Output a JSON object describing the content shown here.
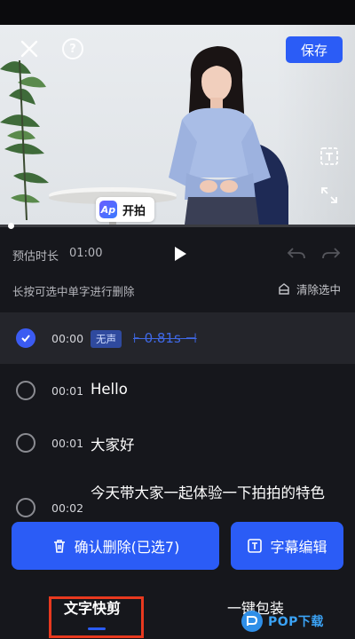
{
  "header": {
    "save_label": "保存",
    "help_glyph": "?"
  },
  "video": {
    "logo_mark": "Ap",
    "logo_text": "开拍",
    "progress": 0.02
  },
  "controls": {
    "estimate_label": "预估时长",
    "estimate_value": "01:00"
  },
  "hint": {
    "text": "长按可选中单字进行删除",
    "clear_label": "清除选中"
  },
  "list": {
    "items": [
      {
        "time": "00:00",
        "badge": "无声",
        "duration": "0.81s",
        "selected": true
      },
      {
        "time": "00:01",
        "text": "Hello",
        "selected": false
      },
      {
        "time": "00:01",
        "text": "大家好",
        "selected": false
      },
      {
        "time": "00:02",
        "text": "今天带大家一起体验一下拍拍的特色",
        "selected": false
      }
    ]
  },
  "actions": {
    "confirm_delete_label": "确认删除(已选7)",
    "subtitle_edit_label": "字幕编辑"
  },
  "tabs": {
    "items": [
      "文字快剪",
      "一键包装"
    ],
    "active_index": 0
  },
  "colors": {
    "accent": "#2b5cf6",
    "background": "#16171c",
    "annotation": "#e8391f"
  },
  "watermark": "POP下载"
}
